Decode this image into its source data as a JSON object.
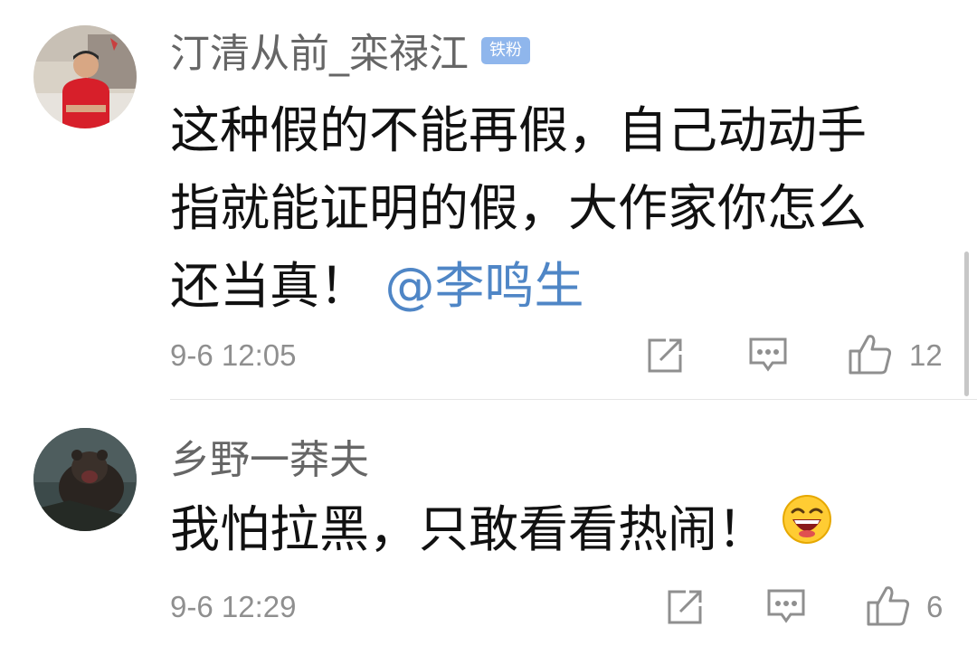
{
  "comments": [
    {
      "username": "汀清从前_栾禄江",
      "badge": "铁粉",
      "text_lines": [
        "这种假的不能再假，自己动动手",
        "指就能证明的假，大作家你怎么",
        "还当真！"
      ],
      "mention": "@李鸣生",
      "time": "9-6 12:05",
      "like_count": "12"
    },
    {
      "username": "乡野一莽夫",
      "text": "我怕拉黑，只敢看看热闹！",
      "emoji": "laughing-face-emoji",
      "time": "9-6 12:29",
      "like_count": "6"
    }
  ],
  "icons": {
    "share": "share-icon",
    "reply": "reply-icon",
    "like": "thumbs-up-icon"
  },
  "colors": {
    "username": "#666666",
    "text": "#111111",
    "mention": "#4f86c6",
    "meta": "#8f8f8f",
    "badge_bg": "#8fb6ec"
  }
}
